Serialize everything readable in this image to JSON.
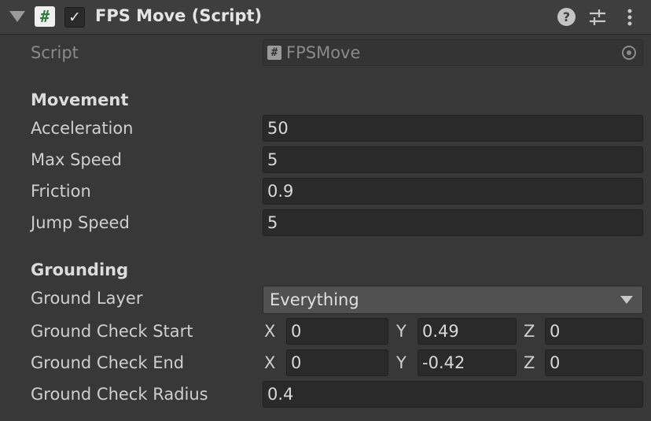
{
  "header": {
    "title": "FPS Move (Script)",
    "icons": [
      "foldout-arrow-icon",
      "script-hash-icon",
      "checkbox-check-icon",
      "help-icon",
      "presets-sliders-icon",
      "more-kebab-icon"
    ],
    "enabled": true
  },
  "script_row": {
    "label": "Script",
    "value": "FPSMove",
    "hash": "#"
  },
  "movement": {
    "heading": "Movement",
    "fields": [
      {
        "label": "Acceleration",
        "value": "50"
      },
      {
        "label": "Max Speed",
        "value": "5"
      },
      {
        "label": "Friction",
        "value": "0.9"
      },
      {
        "label": "Jump Speed",
        "value": "5"
      }
    ]
  },
  "grounding": {
    "heading": "Grounding",
    "ground_layer": {
      "label": "Ground Layer",
      "value": "Everything"
    },
    "check_start": {
      "label": "Ground Check Start",
      "x": "0",
      "y": "0.49",
      "z": "0"
    },
    "check_end": {
      "label": "Ground Check End",
      "x": "0",
      "y": "-0.42",
      "z": "0"
    },
    "check_radius": {
      "label": "Ground Check Radius",
      "value": "0.4"
    }
  },
  "axes": {
    "x": "X",
    "y": "Y",
    "z": "Z"
  },
  "colors": {
    "panel": "#383838",
    "field": "#2a2a2a",
    "header": "#3e3e3e",
    "script_icon": "#2d7d3a"
  }
}
